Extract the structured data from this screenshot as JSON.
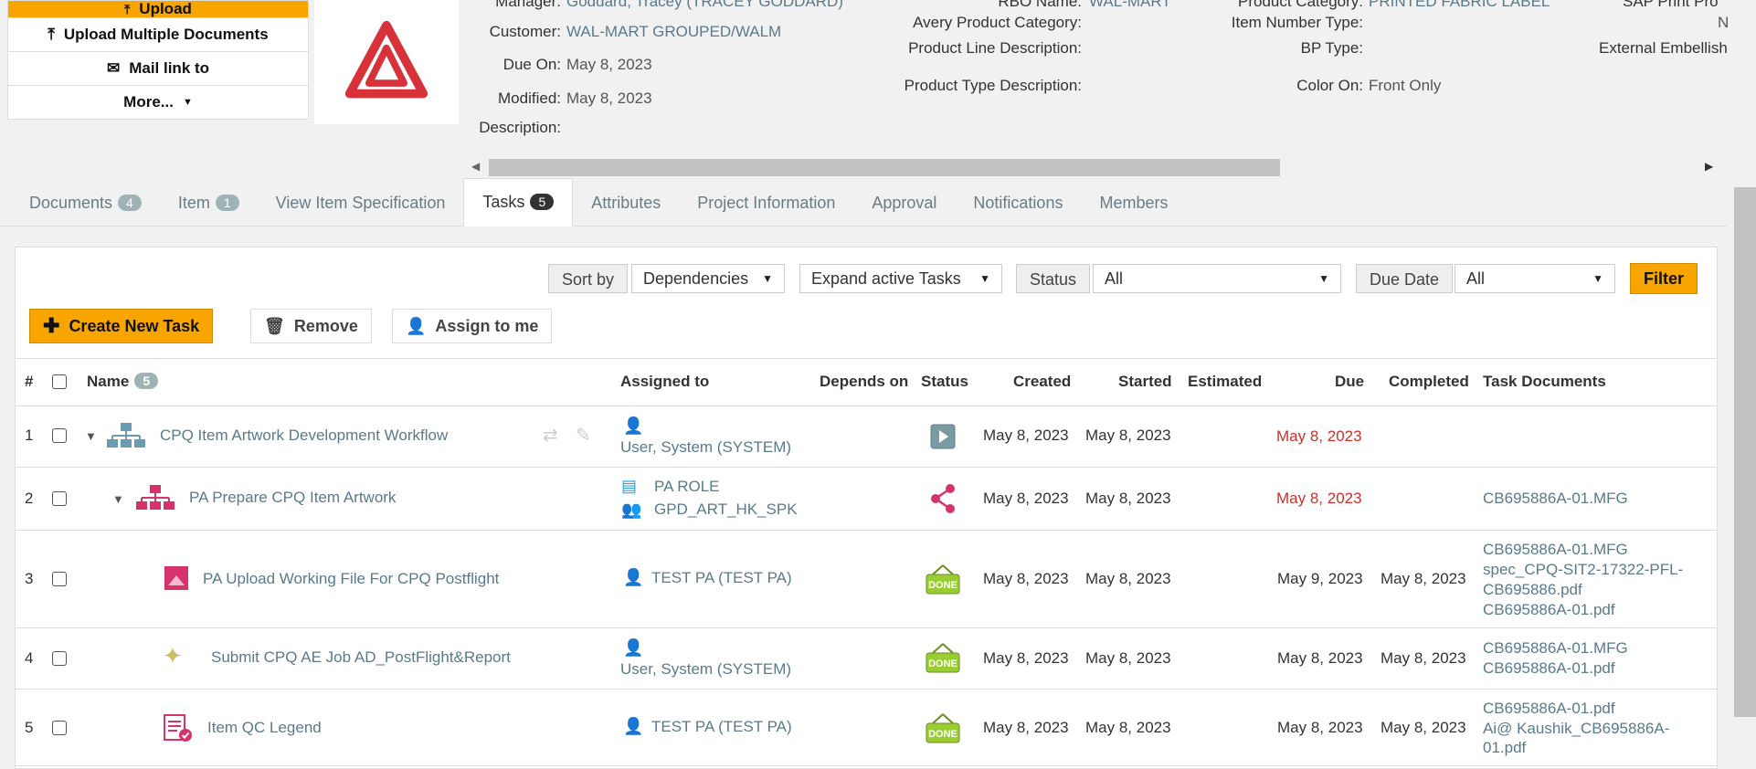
{
  "actions": {
    "upload": "Upload",
    "upload_multiple": "Upload Multiple Documents",
    "mail_link": "Mail link to",
    "more": "More..."
  },
  "info": {
    "manager_label": "Manager:",
    "manager_value": "Goddard, Tracey (TRACEY GODDARD)",
    "customer_label": "Customer:",
    "customer_value": "WAL-MART GROUPED/WALM",
    "due_on_label": "Due On:",
    "due_on_value": "May 8, 2023",
    "modified_label": "Modified:",
    "modified_value": "May 8, 2023",
    "description_label": "Description:",
    "rbo_label": "RBO Name:",
    "rbo_value": "WAL-MART",
    "avery_cat_label": "Avery Product Category:",
    "product_line_label": "Product Line Description:",
    "product_type_label": "Product Type Description:",
    "product_category_label": "Product Category:",
    "product_category_value": "PRINTED FABRIC LABEL",
    "item_number_type_label": "Item Number Type:",
    "item_number_type_value": "N",
    "bp_type_label": "BP Type:",
    "color_on_label": "Color On:",
    "color_on_value": "Front Only",
    "sap_label": "SAP Print Pro",
    "external_emb_label": "External Embellish"
  },
  "tabs": [
    {
      "label": "Documents",
      "count": "4"
    },
    {
      "label": "Item",
      "count": "1"
    },
    {
      "label": "View Item Specification",
      "count": ""
    },
    {
      "label": "Tasks",
      "count": "5"
    },
    {
      "label": "Attributes",
      "count": ""
    },
    {
      "label": "Project Information",
      "count": ""
    },
    {
      "label": "Approval",
      "count": ""
    },
    {
      "label": "Notifications",
      "count": ""
    },
    {
      "label": "Members",
      "count": ""
    }
  ],
  "controls": {
    "sort_by_label": "Sort by",
    "sort_by_value": "Dependencies",
    "expand_label": "Expand active Tasks",
    "status_label": "Status",
    "status_value": "All",
    "due_date_label": "Due Date",
    "due_date_value": "All",
    "filter_label": "Filter",
    "create_task_label": "Create New Task",
    "remove_label": "Remove",
    "assign_label": "Assign to me"
  },
  "table": {
    "headers": {
      "num": "#",
      "name": "Name",
      "name_count": "5",
      "assigned": "Assigned to",
      "depends": "Depends on",
      "status": "Status",
      "created": "Created",
      "started": "Started",
      "estimated": "Estimated",
      "due": "Due",
      "completed": "Completed",
      "docs": "Task Documents"
    },
    "rows": [
      {
        "num": "1",
        "name": "CPQ Item Artwork Development Workflow",
        "assigned": [
          "User, System (SYSTEM)"
        ],
        "created": "May 8, 2023",
        "started": "May 8, 2023",
        "due": "May 8, 2023",
        "completed": "",
        "docs": []
      },
      {
        "num": "2",
        "name": "PA Prepare CPQ Item Artwork",
        "assigned": [
          "PA ROLE",
          "GPD_ART_HK_SPK"
        ],
        "created": "May 8, 2023",
        "started": "May 8, 2023",
        "due": "May 8, 2023",
        "completed": "",
        "docs": [
          "CB695886A-01.MFG"
        ]
      },
      {
        "num": "3",
        "name": "PA Upload Working File For CPQ Postflight",
        "assigned": [
          "TEST PA (TEST PA)"
        ],
        "created": "May 8, 2023",
        "started": "May 8, 2023",
        "due": "May 9, 2023",
        "completed": "May 8, 2023",
        "docs": [
          "CB695886A-01.MFG",
          "spec_CPQ-SIT2-17322-PFL-",
          "CB695886.pdf",
          "CB695886A-01.pdf"
        ]
      },
      {
        "num": "4",
        "name": "Submit CPQ AE Job AD_PostFlight&Report",
        "assigned": [
          "User, System (SYSTEM)"
        ],
        "created": "May 8, 2023",
        "started": "May 8, 2023",
        "due": "May 8, 2023",
        "completed": "May 8, 2023",
        "docs": [
          "CB695886A-01.MFG",
          "CB695886A-01.pdf"
        ]
      },
      {
        "num": "5",
        "name": "Item QC Legend",
        "assigned": [
          "TEST PA (TEST PA)"
        ],
        "created": "May 8, 2023",
        "started": "May 8, 2023",
        "due": "May 8, 2023",
        "completed": "May 8, 2023",
        "docs": [
          "CB695886A-01.pdf",
          "Ai@ Kaushik_CB695886A-",
          "01.pdf"
        ]
      }
    ],
    "status_done": "DONE"
  },
  "colors": {
    "accent": "#f8a500",
    "overdue": "#c9302c",
    "link": "#5a7a8a",
    "logo": "#d7323a"
  }
}
